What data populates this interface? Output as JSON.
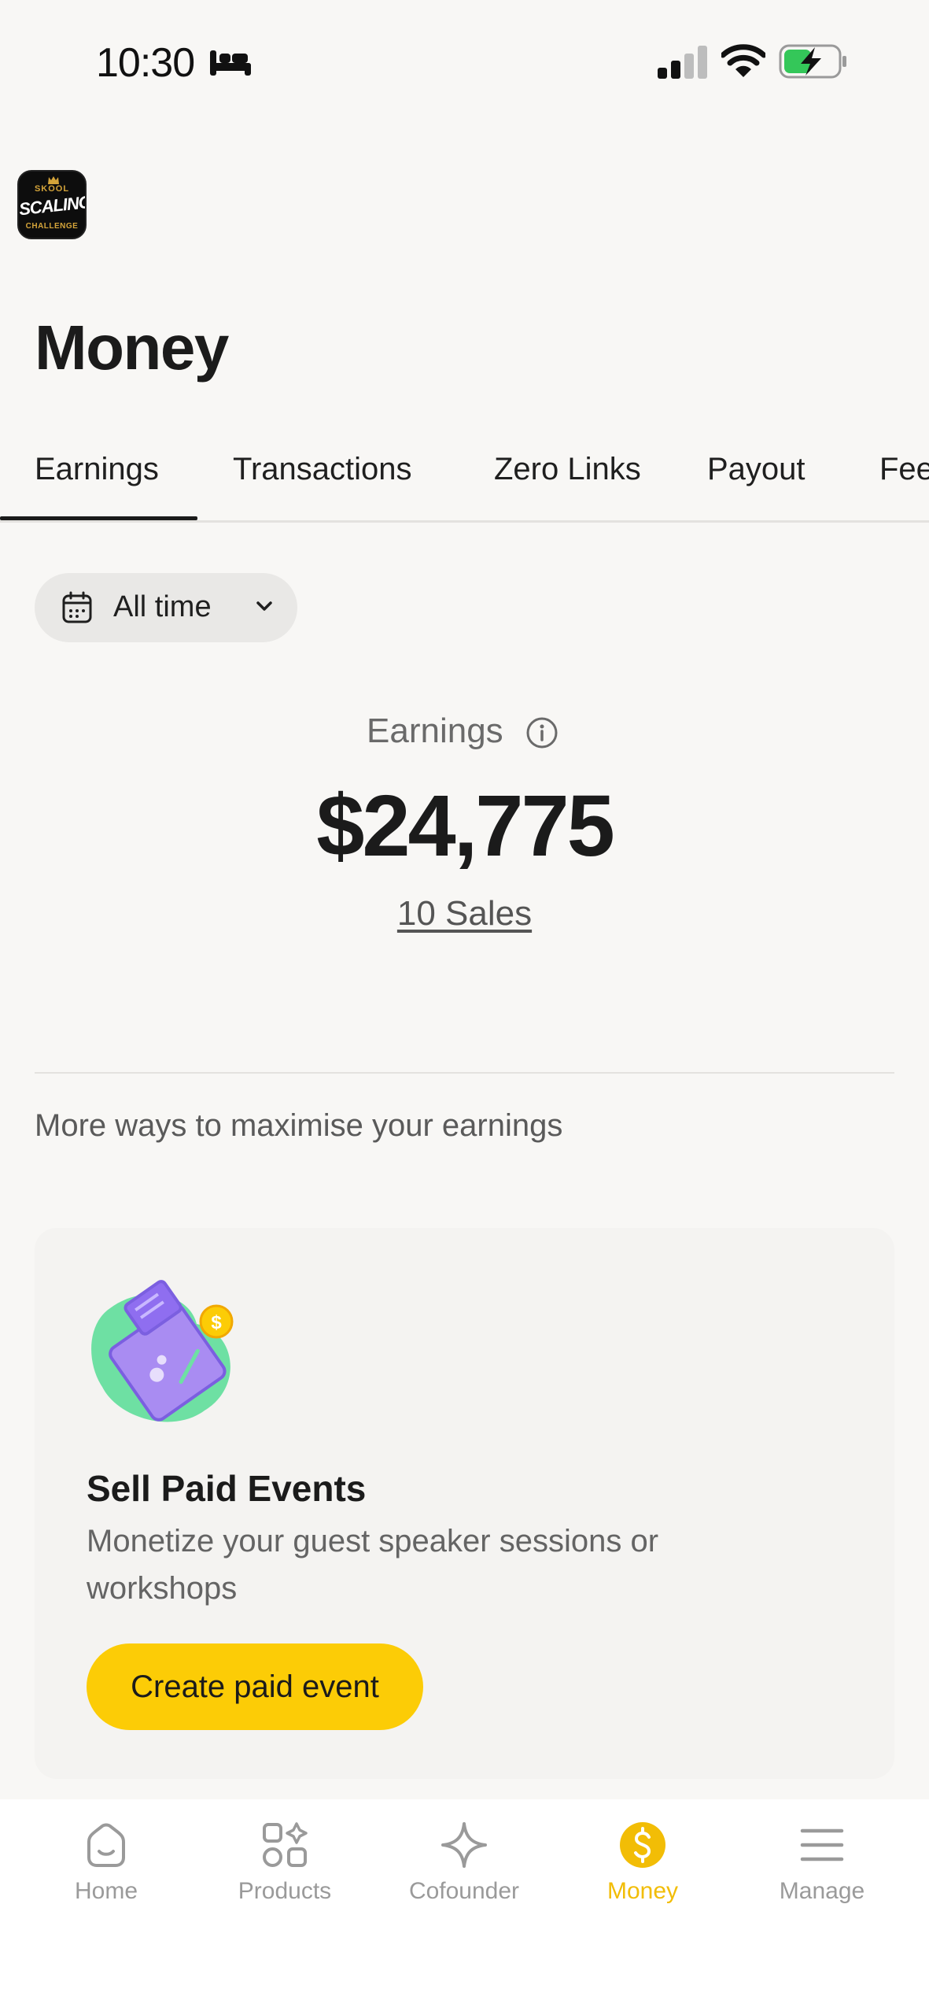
{
  "status_bar": {
    "time": "10:30",
    "sleep_icon": "bed-icon",
    "signal_icon": "cellular-signal-icon",
    "wifi_icon": "wifi-icon",
    "battery_icon": "battery-charging-icon"
  },
  "app_logo": {
    "line1": "SKOOL",
    "line2": "SCALING",
    "line3": "CHALLENGE"
  },
  "page": {
    "title": "Money"
  },
  "tabs": [
    {
      "label": "Earnings",
      "active": true
    },
    {
      "label": "Transactions"
    },
    {
      "label": "Zero Links"
    },
    {
      "label": "Payout"
    },
    {
      "label": "Fee"
    }
  ],
  "date_filter": {
    "label": "All time",
    "icon": "calendar-icon"
  },
  "earnings": {
    "label": "Earnings",
    "amount": "$24,775",
    "sales": "10 Sales"
  },
  "more_ways": "More ways to maximise your earnings",
  "card": {
    "title": "Sell Paid Events",
    "description": "Monetize your guest speaker sessions or workshops",
    "button": "Create paid event",
    "illustration": "ticket-illustration"
  },
  "bottom_nav": [
    {
      "label": "Home",
      "icon": "home-icon"
    },
    {
      "label": "Products",
      "icon": "products-icon"
    },
    {
      "label": "Cofounder",
      "icon": "sparkle-icon"
    },
    {
      "label": "Money",
      "icon": "dollar-icon",
      "active": true
    },
    {
      "label": "Manage",
      "icon": "menu-icon"
    }
  ],
  "colors": {
    "accent": "#fccc06",
    "active_nav": "#f2bd06",
    "background": "#f8f7f5"
  }
}
